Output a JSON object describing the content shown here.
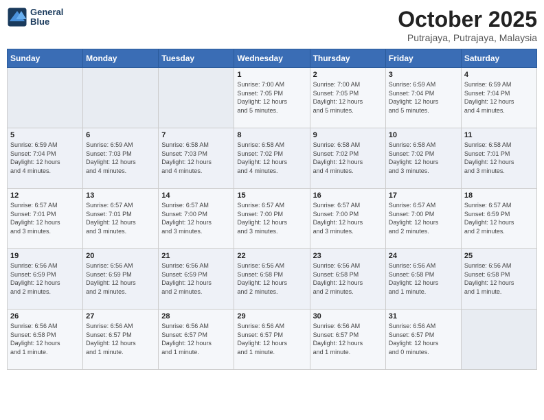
{
  "header": {
    "logo_line1": "General",
    "logo_line2": "Blue",
    "title": "October 2025",
    "subtitle": "Putrajaya, Putrajaya, Malaysia"
  },
  "days_of_week": [
    "Sunday",
    "Monday",
    "Tuesday",
    "Wednesday",
    "Thursday",
    "Friday",
    "Saturday"
  ],
  "weeks": [
    [
      {
        "day": "",
        "info": ""
      },
      {
        "day": "",
        "info": ""
      },
      {
        "day": "",
        "info": ""
      },
      {
        "day": "1",
        "info": "Sunrise: 7:00 AM\nSunset: 7:05 PM\nDaylight: 12 hours\nand 5 minutes."
      },
      {
        "day": "2",
        "info": "Sunrise: 7:00 AM\nSunset: 7:05 PM\nDaylight: 12 hours\nand 5 minutes."
      },
      {
        "day": "3",
        "info": "Sunrise: 6:59 AM\nSunset: 7:04 PM\nDaylight: 12 hours\nand 5 minutes."
      },
      {
        "day": "4",
        "info": "Sunrise: 6:59 AM\nSunset: 7:04 PM\nDaylight: 12 hours\nand 4 minutes."
      }
    ],
    [
      {
        "day": "5",
        "info": "Sunrise: 6:59 AM\nSunset: 7:04 PM\nDaylight: 12 hours\nand 4 minutes."
      },
      {
        "day": "6",
        "info": "Sunrise: 6:59 AM\nSunset: 7:03 PM\nDaylight: 12 hours\nand 4 minutes."
      },
      {
        "day": "7",
        "info": "Sunrise: 6:58 AM\nSunset: 7:03 PM\nDaylight: 12 hours\nand 4 minutes."
      },
      {
        "day": "8",
        "info": "Sunrise: 6:58 AM\nSunset: 7:02 PM\nDaylight: 12 hours\nand 4 minutes."
      },
      {
        "day": "9",
        "info": "Sunrise: 6:58 AM\nSunset: 7:02 PM\nDaylight: 12 hours\nand 4 minutes."
      },
      {
        "day": "10",
        "info": "Sunrise: 6:58 AM\nSunset: 7:02 PM\nDaylight: 12 hours\nand 3 minutes."
      },
      {
        "day": "11",
        "info": "Sunrise: 6:58 AM\nSunset: 7:01 PM\nDaylight: 12 hours\nand 3 minutes."
      }
    ],
    [
      {
        "day": "12",
        "info": "Sunrise: 6:57 AM\nSunset: 7:01 PM\nDaylight: 12 hours\nand 3 minutes."
      },
      {
        "day": "13",
        "info": "Sunrise: 6:57 AM\nSunset: 7:01 PM\nDaylight: 12 hours\nand 3 minutes."
      },
      {
        "day": "14",
        "info": "Sunrise: 6:57 AM\nSunset: 7:00 PM\nDaylight: 12 hours\nand 3 minutes."
      },
      {
        "day": "15",
        "info": "Sunrise: 6:57 AM\nSunset: 7:00 PM\nDaylight: 12 hours\nand 3 minutes."
      },
      {
        "day": "16",
        "info": "Sunrise: 6:57 AM\nSunset: 7:00 PM\nDaylight: 12 hours\nand 3 minutes."
      },
      {
        "day": "17",
        "info": "Sunrise: 6:57 AM\nSunset: 7:00 PM\nDaylight: 12 hours\nand 2 minutes."
      },
      {
        "day": "18",
        "info": "Sunrise: 6:57 AM\nSunset: 6:59 PM\nDaylight: 12 hours\nand 2 minutes."
      }
    ],
    [
      {
        "day": "19",
        "info": "Sunrise: 6:56 AM\nSunset: 6:59 PM\nDaylight: 12 hours\nand 2 minutes."
      },
      {
        "day": "20",
        "info": "Sunrise: 6:56 AM\nSunset: 6:59 PM\nDaylight: 12 hours\nand 2 minutes."
      },
      {
        "day": "21",
        "info": "Sunrise: 6:56 AM\nSunset: 6:59 PM\nDaylight: 12 hours\nand 2 minutes."
      },
      {
        "day": "22",
        "info": "Sunrise: 6:56 AM\nSunset: 6:58 PM\nDaylight: 12 hours\nand 2 minutes."
      },
      {
        "day": "23",
        "info": "Sunrise: 6:56 AM\nSunset: 6:58 PM\nDaylight: 12 hours\nand 2 minutes."
      },
      {
        "day": "24",
        "info": "Sunrise: 6:56 AM\nSunset: 6:58 PM\nDaylight: 12 hours\nand 1 minute."
      },
      {
        "day": "25",
        "info": "Sunrise: 6:56 AM\nSunset: 6:58 PM\nDaylight: 12 hours\nand 1 minute."
      }
    ],
    [
      {
        "day": "26",
        "info": "Sunrise: 6:56 AM\nSunset: 6:58 PM\nDaylight: 12 hours\nand 1 minute."
      },
      {
        "day": "27",
        "info": "Sunrise: 6:56 AM\nSunset: 6:57 PM\nDaylight: 12 hours\nand 1 minute."
      },
      {
        "day": "28",
        "info": "Sunrise: 6:56 AM\nSunset: 6:57 PM\nDaylight: 12 hours\nand 1 minute."
      },
      {
        "day": "29",
        "info": "Sunrise: 6:56 AM\nSunset: 6:57 PM\nDaylight: 12 hours\nand 1 minute."
      },
      {
        "day": "30",
        "info": "Sunrise: 6:56 AM\nSunset: 6:57 PM\nDaylight: 12 hours\nand 1 minute."
      },
      {
        "day": "31",
        "info": "Sunrise: 6:56 AM\nSunset: 6:57 PM\nDaylight: 12 hours\nand 0 minutes."
      },
      {
        "day": "",
        "info": ""
      }
    ]
  ]
}
